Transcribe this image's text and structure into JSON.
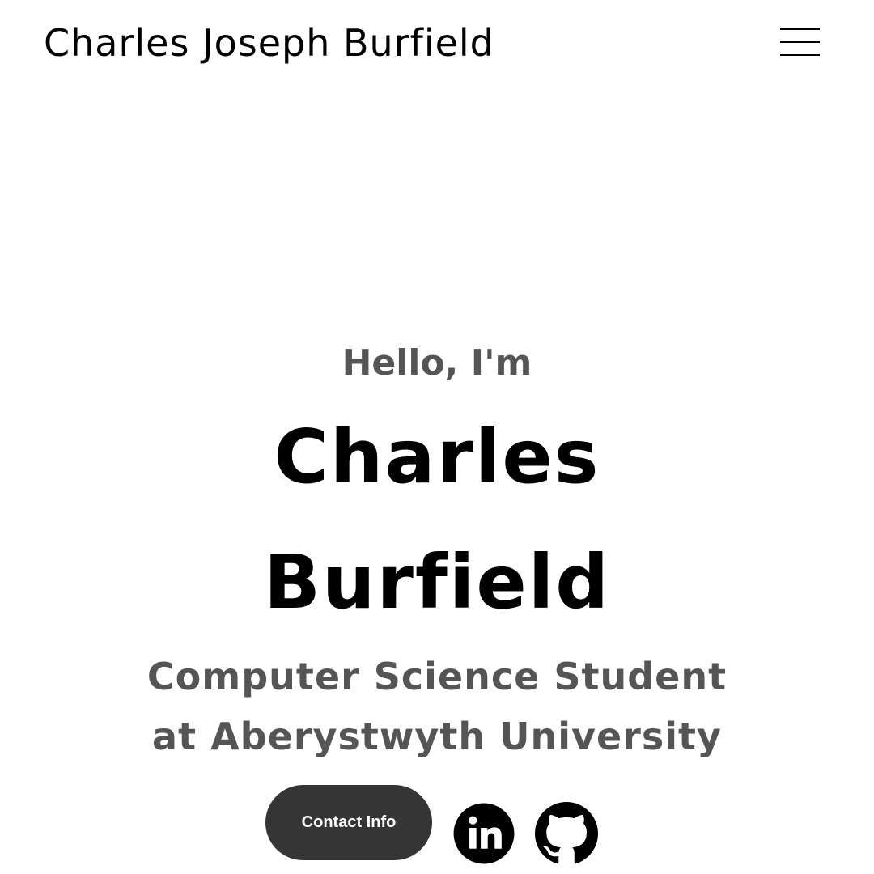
{
  "header": {
    "site_title": "Charles Joseph Burfield",
    "menu_icon": "hamburger-menu-icon"
  },
  "hero": {
    "greeting": "Hello, I'm",
    "name_first": "Charles",
    "name_last": "Burfield",
    "tagline_line1": "Computer Science Student",
    "tagline_line2": "at Aberystwyth University",
    "contact_button_label": "Contact Info"
  },
  "social": {
    "icons": [
      "linkedin-icon",
      "github-icon"
    ]
  },
  "colors": {
    "background": "#ffffff",
    "primary_text": "#000000",
    "secondary_text": "#555555",
    "button_background": "#353535",
    "button_text": "#ffffff"
  }
}
